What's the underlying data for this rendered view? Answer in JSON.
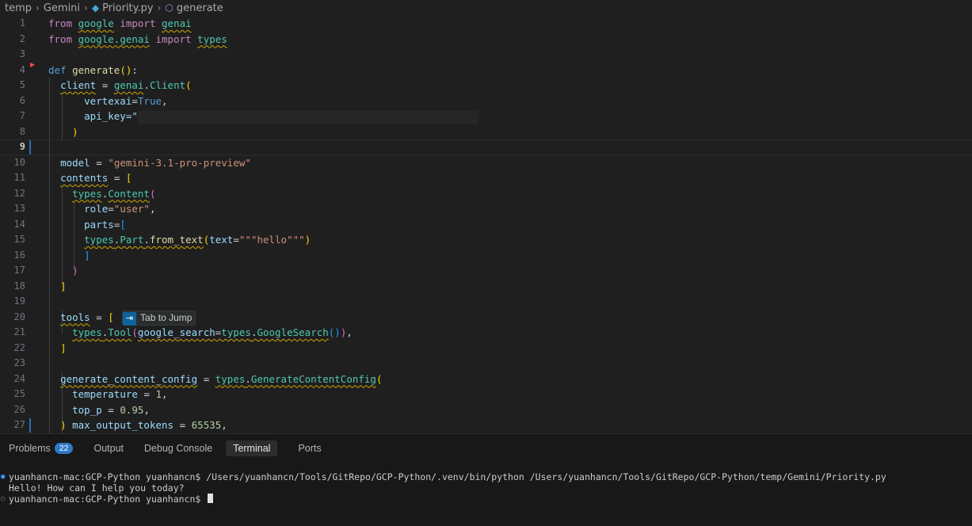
{
  "breadcrumb": {
    "parts": [
      "temp",
      "Gemini",
      "Priority.py",
      "generate"
    ]
  },
  "editor": {
    "line_numbers": [
      "1",
      "2",
      "3",
      "4",
      "5",
      "6",
      "7",
      "8",
      "9",
      "10",
      "11",
      "12",
      "13",
      "14",
      "15",
      "16",
      "17",
      "18",
      "19",
      "20",
      "21",
      "22",
      "23",
      "24",
      "25",
      "26",
      "27"
    ],
    "current_line": "9",
    "model_name": "\"gemini-3.1-pro-preview\"",
    "api_key_prefix": "api_key=\"",
    "hint": {
      "key_symbol": "⇥",
      "label": "Tab to Jump"
    }
  },
  "panel": {
    "tabs": [
      {
        "label": "Problems",
        "badge": "22"
      },
      {
        "label": "Output"
      },
      {
        "label": "Debug Console"
      },
      {
        "label": "Terminal",
        "active": true
      },
      {
        "label": "Ports"
      }
    ],
    "terminal": {
      "lines": [
        "yuanhancn-mac:GCP-Python yuanhancn$ /Users/yuanhancn/Tools/GitRepo/GCP-Python/.venv/bin/python /Users/yuanhancn/Tools/GitRepo/GCP-Python/temp/Gemini/Priority.py",
        "Hello! How can I help you today?",
        "yuanhancn-mac:GCP-Python yuanhancn$ "
      ]
    }
  },
  "colors": {
    "background": "#1f1f1f",
    "keyword": "#c586c0",
    "function": "#dcdcaa",
    "string": "#ce9178",
    "accent": "#2f79c8"
  }
}
